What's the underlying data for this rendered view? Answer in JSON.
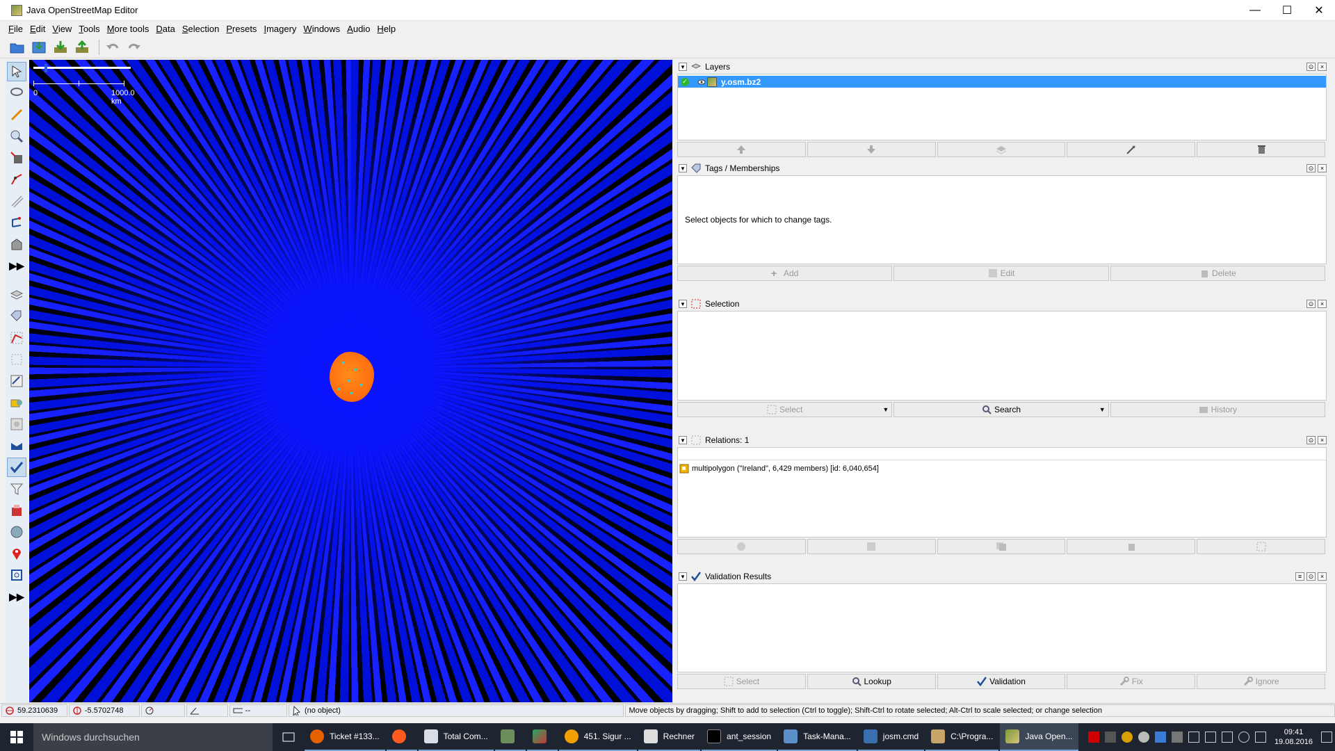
{
  "window": {
    "title": "Java OpenStreetMap Editor"
  },
  "menu": [
    "File",
    "Edit",
    "View",
    "Tools",
    "More tools",
    "Data",
    "Selection",
    "Presets",
    "Imagery",
    "Windows",
    "Audio",
    "Help"
  ],
  "map": {
    "scale_left": "0",
    "scale_right": "1000.0 km"
  },
  "layers": {
    "title": "Layers",
    "items": [
      {
        "name": "y.osm.bz2",
        "selected": true,
        "visible": true,
        "active": true
      }
    ]
  },
  "tags": {
    "title": "Tags / Memberships",
    "empty_text": "Select objects for which to change tags.",
    "buttons": {
      "add": "Add",
      "edit": "Edit",
      "delete": "Delete"
    }
  },
  "selection": {
    "title": "Selection",
    "buttons": {
      "select": "Select",
      "search": "Search",
      "history": "History"
    }
  },
  "relations": {
    "title": "Relations: 1",
    "items": [
      "multipolygon (\"Ireland\", 6,429 members) [id: 6,040,654]"
    ]
  },
  "validation": {
    "title": "Validation Results",
    "buttons": {
      "select": "Select",
      "lookup": "Lookup",
      "validation": "Validation",
      "fix": "Fix",
      "ignore": "Ignore"
    }
  },
  "status": {
    "lat": "59.2310639",
    "lon": "-5.5702748",
    "heading": "",
    "angle": "",
    "length": "--",
    "object": "(no object)",
    "help": "Move objects by dragging; Shift to add to selection (Ctrl to toggle); Shift-Ctrl to rotate selected; Alt-Ctrl to scale selected; or change selection"
  },
  "taskbar": {
    "search_placeholder": "Windows durchsuchen",
    "tasks": [
      {
        "label": "Ticket #133...",
        "icon": "firefox-icon"
      },
      {
        "label": "",
        "icon": "firefox-dev-icon"
      },
      {
        "label": "Total Com...",
        "icon": "totalcommander-icon"
      },
      {
        "label": "",
        "icon": "app-grid-icon"
      },
      {
        "label": "",
        "icon": "pen-icon"
      },
      {
        "label": "451. Sigur ...",
        "icon": "media-icon"
      },
      {
        "label": "Rechner",
        "icon": "calculator-icon"
      },
      {
        "label": "ant_session",
        "icon": "terminal-icon"
      },
      {
        "label": "Task-Mana...",
        "icon": "taskmanager-icon"
      },
      {
        "label": "josm.cmd",
        "icon": "cmd-icon"
      },
      {
        "label": "C:\\Progra...",
        "icon": "java-icon"
      },
      {
        "label": "Java Open...",
        "icon": "josm-icon",
        "active": true
      }
    ],
    "time": "09:41",
    "date": "19.08.2016"
  },
  "colors": {
    "selection_blue": "#3399ff",
    "map_blue": "#0a14ff",
    "multipolygon_orange": "#ff7a10",
    "taskbar": "#1f2530"
  }
}
